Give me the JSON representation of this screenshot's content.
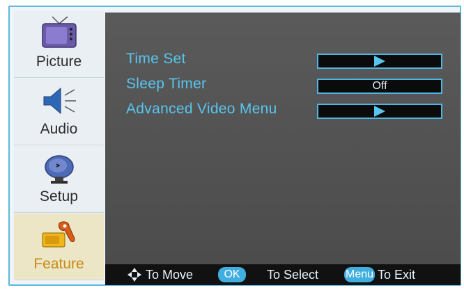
{
  "sidebar": {
    "items": [
      {
        "label": "Picture",
        "icon": "tv-icon"
      },
      {
        "label": "Audio",
        "icon": "speaker-icon"
      },
      {
        "label": "Setup",
        "icon": "satellite-dish-icon"
      },
      {
        "label": "Feature",
        "icon": "wrench-icon",
        "active": true
      }
    ]
  },
  "menu": {
    "rows": [
      {
        "label": "Time Set",
        "value": ""
      },
      {
        "label": "Sleep Timer",
        "value": "Off"
      },
      {
        "label": "Advanced Video Menu",
        "value": ""
      }
    ]
  },
  "footer": {
    "move": "To Move",
    "ok": "OK",
    "select": "To Select",
    "menu": "Menu",
    "exit": "To Exit"
  },
  "colors": {
    "accent": "#58c5ef",
    "frame": "#5fb8dc",
    "active_label": "#c98a10"
  }
}
